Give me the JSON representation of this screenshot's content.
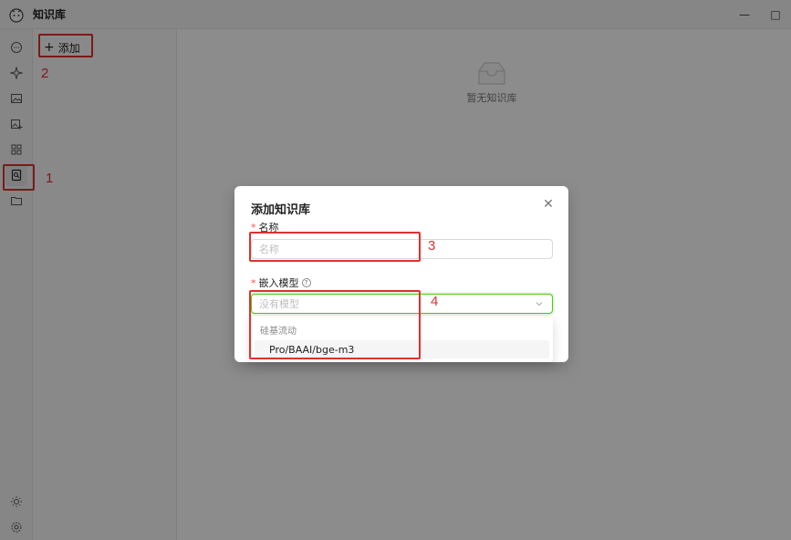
{
  "app": {
    "title": "知识库"
  },
  "window_controls": {
    "minimize": "—",
    "maximize": "□"
  },
  "sidebar": {
    "icons": [
      "chat-icon",
      "sparkle-icon",
      "image-icon",
      "image-add-icon",
      "apps-grid-icon",
      "knowledge-base-icon",
      "folder-icon",
      "sun-icon",
      "settings-icon"
    ]
  },
  "kb_panel": {
    "add_label": "添加",
    "plus": "+"
  },
  "main": {
    "empty_text": "暂无知识库"
  },
  "modal": {
    "title": "添加知识库",
    "close": "✕",
    "name_label": "名称",
    "name_placeholder": "名称",
    "model_label": "嵌入模型",
    "help": "?",
    "required_mark": "*",
    "model_placeholder": "没有模型"
  },
  "dropdown": {
    "group": "硅基流动",
    "options": [
      "Pro/BAAI/bge-m3"
    ]
  },
  "annotations": [
    "1",
    "2",
    "3",
    "4"
  ],
  "colors": {
    "annotation": "#e0312d",
    "focus": "#52c41a",
    "required": "#ff4d4f"
  }
}
